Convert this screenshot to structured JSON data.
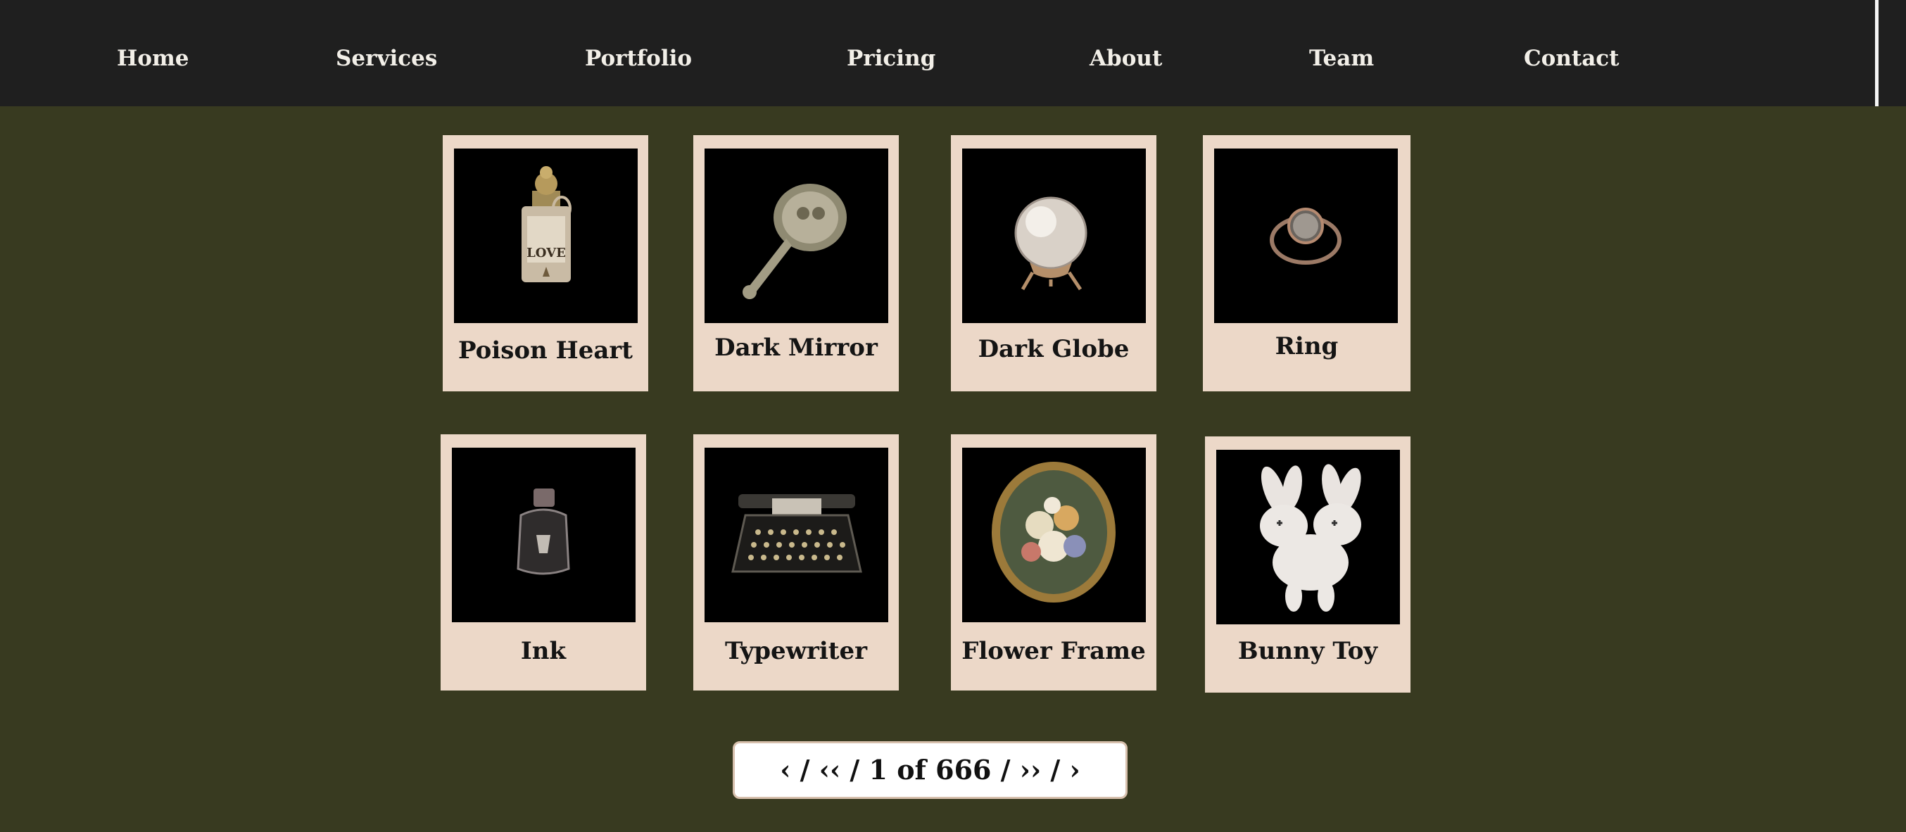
{
  "nav": {
    "items": [
      "Home",
      "Services",
      "Portfolio",
      "Pricing",
      "About",
      "Team",
      "Contact"
    ]
  },
  "colors": {
    "background": "#383a20",
    "nav_background": "#1f1f1f",
    "card": "#ecd8c8",
    "card_image_background": "#000000"
  },
  "products": [
    {
      "title": "Poison Heart",
      "icon": "perfume-bottle-icon"
    },
    {
      "title": "Dark Mirror",
      "icon": "hand-mirror-icon"
    },
    {
      "title": "Dark Globe",
      "icon": "crystal-ball-icon"
    },
    {
      "title": "Ring",
      "icon": "ring-icon"
    },
    {
      "title": "Ink",
      "icon": "ink-bottle-icon"
    },
    {
      "title": "Typewriter",
      "icon": "typewriter-icon"
    },
    {
      "title": "Flower Frame",
      "icon": "flower-frame-icon"
    },
    {
      "title": "Bunny Toy",
      "icon": "bunny-toy-icon"
    }
  ],
  "pagination": {
    "prev": "‹",
    "first": "‹‹",
    "status": "1 of 666",
    "last": "››",
    "next": "›",
    "separator": " / "
  }
}
